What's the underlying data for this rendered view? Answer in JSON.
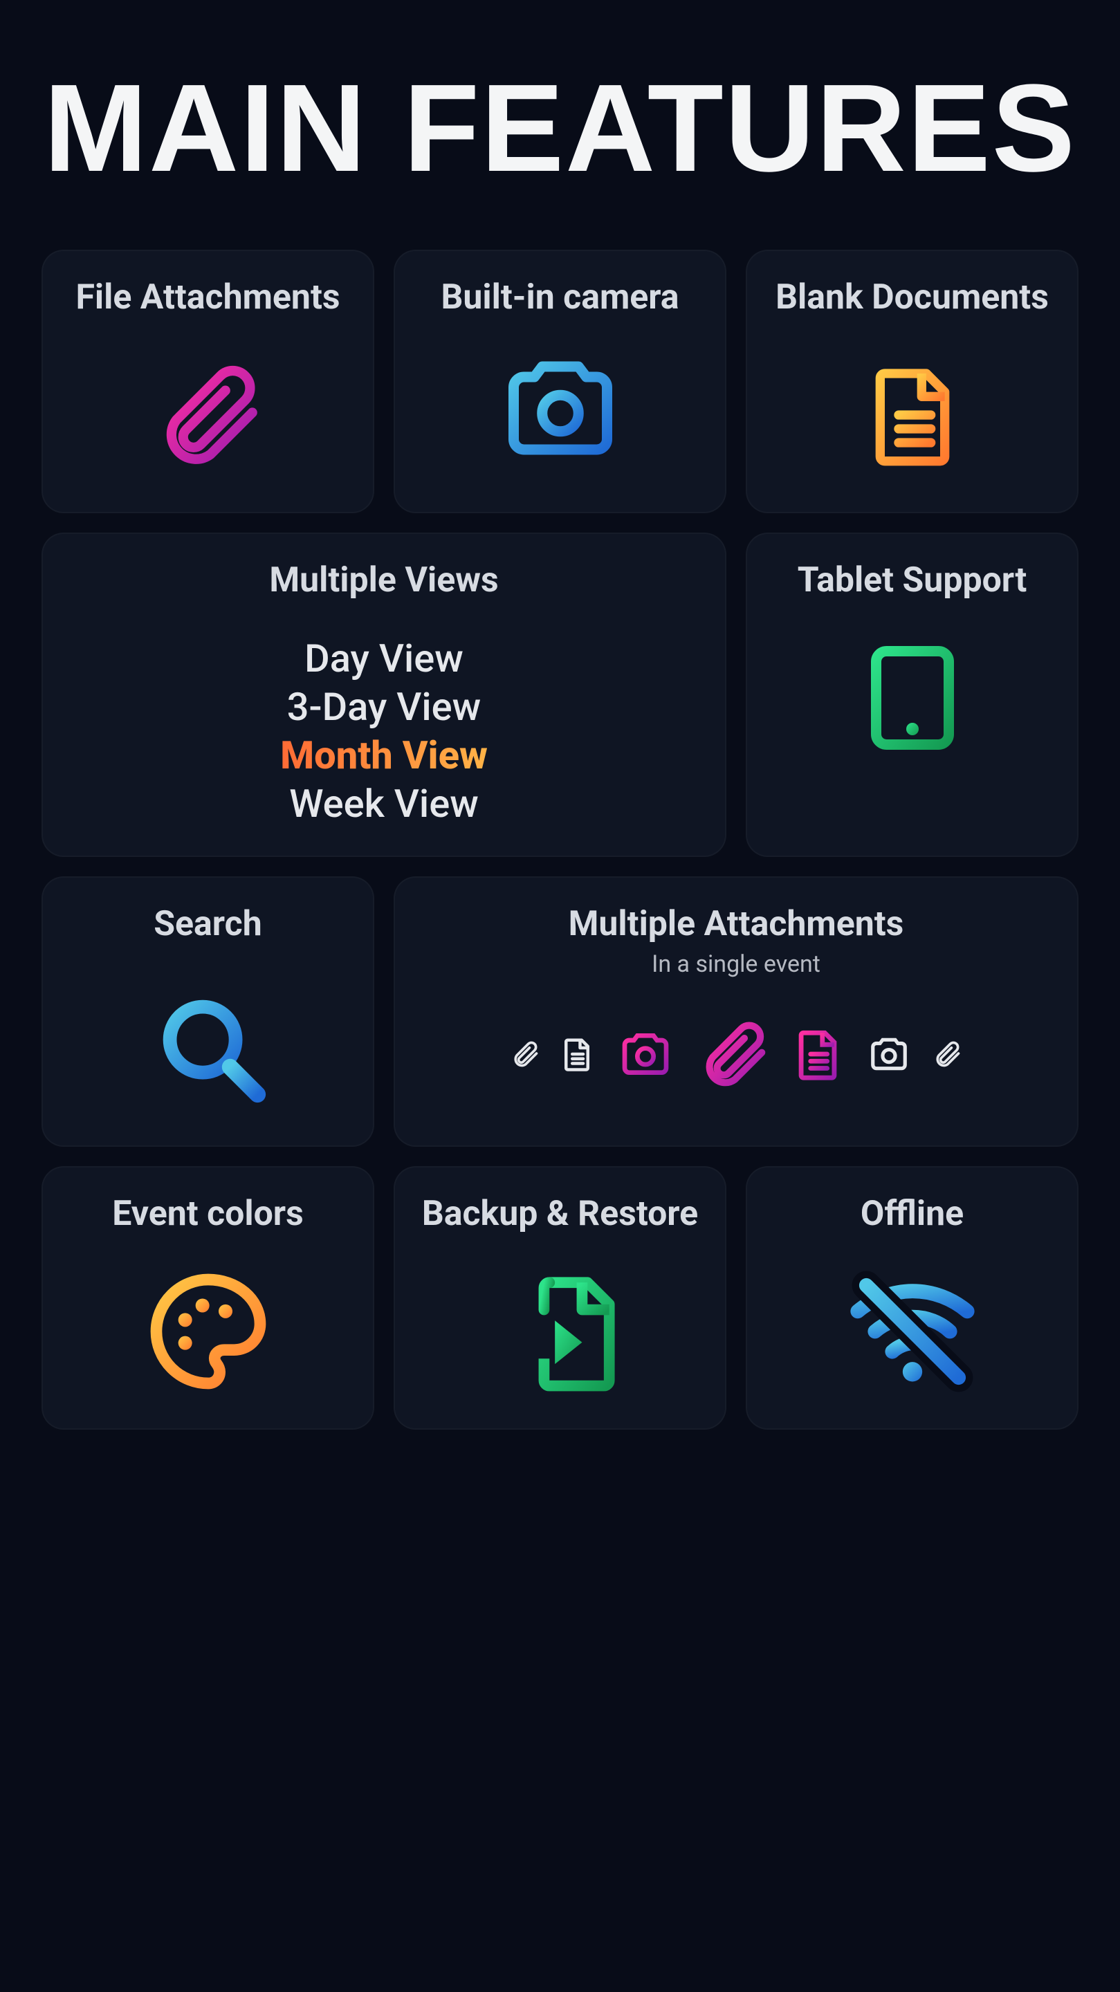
{
  "title": "MAIN FEATURES",
  "cards": {
    "file_attachments": {
      "title": "File Attachments"
    },
    "camera": {
      "title": "Built-in camera"
    },
    "blank_docs": {
      "title": "Blank Documents"
    },
    "views": {
      "title": "Multiple Views",
      "options": [
        "Day View",
        "3-Day View",
        "Month View",
        "Week View"
      ],
      "highlight_index": 2
    },
    "tablet": {
      "title": "Tablet Support"
    },
    "search": {
      "title": "Search"
    },
    "multi_attach": {
      "title": "Multiple Attachments",
      "subtitle": "In a single event"
    },
    "colors": {
      "title": "Event colors"
    },
    "backup": {
      "title": "Backup & Restore"
    },
    "offline": {
      "title": "Offline"
    }
  },
  "palette": {
    "pink1": "#ff2fa0",
    "pink2": "#c0188c",
    "blue1": "#51c8e8",
    "blue2": "#1f6bd6",
    "orange1": "#ffc845",
    "orange2": "#ff7a2f",
    "green1": "#2de38a",
    "green2": "#149a52"
  }
}
